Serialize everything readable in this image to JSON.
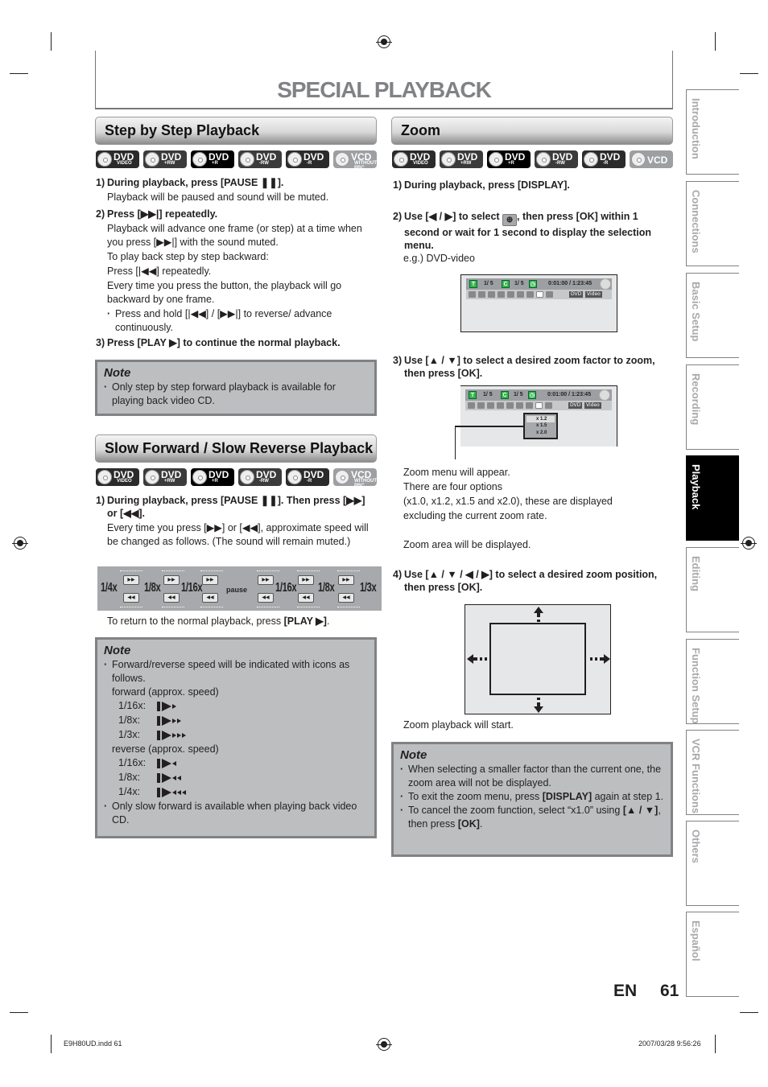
{
  "page_title": "SPECIAL PLAYBACK",
  "disc_types": [
    {
      "label": "DVD",
      "sub": "VIDEO"
    },
    {
      "label": "DVD",
      "sub": "+RW"
    },
    {
      "label": "DVD",
      "sub": "+R"
    },
    {
      "label": "DVD",
      "sub": "-RW"
    },
    {
      "label": "DVD",
      "sub": "-R"
    },
    {
      "label": "VCD",
      "sub": "WITHOUT PBC"
    }
  ],
  "zoom_disc_last": {
    "label": "VCD",
    "sub": ""
  },
  "step_by_step": {
    "heading": "Step by Step Playback",
    "step1_num": "1)",
    "step1": "During playback, press [PAUSE ❚❚].",
    "step1_desc": "Playback will be paused and sound will be muted.",
    "step2_num": "2)",
    "step2": "Press [▶▶|] repeatedly.",
    "step2_desc": [
      "Playback will advance one frame (or step) at a time when you press [▶▶|] with the sound muted.",
      "To play back step by step backward:",
      "Press [|◀◀] repeatedly.",
      "Every time you press the button, the playback will go backward by one frame."
    ],
    "step2_bullet": "Press and hold [|◀◀] / [▶▶|] to reverse/ advance continuously.",
    "step3_num": "3)",
    "step3": "Press [PLAY ▶] to continue the normal playback.",
    "note_title": "Note",
    "note_items": [
      "Only step by step forward playback is available for playing back video CD."
    ]
  },
  "slow_playback": {
    "heading": "Slow Forward / Slow Reverse Playback",
    "step1_num": "1)",
    "step1": "During playback, press [PAUSE ❚❚]. Then press [▶▶] or [◀◀].",
    "step1_desc": "Every time you press [▶▶] or [◀◀], approximate speed will be changed as follows. (The sound will remain muted.)",
    "speed_labels": [
      "1/4x",
      "1/8x",
      "1/16x",
      "pause",
      "1/16x",
      "1/8x",
      "1/3x"
    ],
    "fwd_btn": "▶▶",
    "rev_btn": "◀◀",
    "return_text_pre": "To return to the normal playback, press ",
    "return_text_key": "[PLAY ▶]",
    "return_text_post": ".",
    "note_title": "Note",
    "note_item1": "Forward/reverse speed will be indicated with icons as follows.",
    "forward_heading": "forward (approx. speed)",
    "forward_speeds": [
      {
        "label": "1/16x:",
        "marks": 1
      },
      {
        "label": "1/8x:",
        "marks": 2
      },
      {
        "label": "1/3x:",
        "marks": 3
      }
    ],
    "reverse_heading": "reverse (approx. speed)",
    "reverse_speeds": [
      {
        "label": "1/16x:",
        "marks": 1
      },
      {
        "label": "1/8x:",
        "marks": 2
      },
      {
        "label": "1/4x:",
        "marks": 3
      }
    ],
    "note_item2": "Only slow forward is available when playing back video CD."
  },
  "zoom": {
    "heading": "Zoom",
    "step1_num": "1)",
    "step1": "During playback, press [DISPLAY].",
    "step2_num": "2)",
    "step2_pre": "Use [◀ / ▶] to select ",
    "step2_post": ", then press [OK] within 1 second or wait for 1 second to display the selection menu.",
    "example": "e.g.) DVD-video",
    "osd": {
      "title_icon": "T",
      "title_val": "1/  5",
      "chapter_icon": "C",
      "chapter_val": "1/  5",
      "time": "0:01:00 / 1:23:45",
      "tag1": "DVD",
      "tag2": "Video"
    },
    "step3_num": "3)",
    "step3": "Use [▲ / ▼] to select a desired zoom factor to zoom, then press [OK].",
    "zoom_options": [
      "x 1.2",
      "x 1.5",
      "x 2.0"
    ],
    "step3_desc": [
      "Zoom menu will appear.",
      "There are four options",
      "(x1.0, x1.2, x1.5 and x2.0), these are displayed",
      "excluding the current zoom rate."
    ],
    "step3_desc2": "Zoom area will be displayed.",
    "step4_num": "4)",
    "step4": "Use [▲ / ▼ / ◀ / ▶] to select a desired zoom position, then press [OK].",
    "step4_desc": "Zoom playback will start.",
    "note_title": "Note",
    "note1": "When selecting a smaller factor than the current one, the zoom area will not be displayed.",
    "note2_pre": "To exit the zoom menu, press ",
    "note2_key": "[DISPLAY]",
    "note2_post": " again at step 1.",
    "note3_pre": "To cancel the zoom function, select “x1.0” using ",
    "note3_key1": "[▲ / ▼]",
    "note3_mid": ", then press ",
    "note3_key2": "[OK]",
    "note3_post": "."
  },
  "side_tabs": [
    {
      "label": "Introduction",
      "active": false
    },
    {
      "label": "Connections",
      "active": false
    },
    {
      "label": "Basic Setup",
      "active": false
    },
    {
      "label": "Recording",
      "active": false
    },
    {
      "label": "Playback",
      "active": true
    },
    {
      "label": "Editing",
      "active": false
    },
    {
      "label": "Function Setup",
      "active": false
    },
    {
      "label": "VCR Functions",
      "active": false
    },
    {
      "label": "Others",
      "active": false
    },
    {
      "label": "Español",
      "active": false
    }
  ],
  "page_lang": "EN",
  "page_number": "61",
  "footer_file": "E9H80UD.indd   61",
  "footer_date": "2007/03/28   9:56:26"
}
